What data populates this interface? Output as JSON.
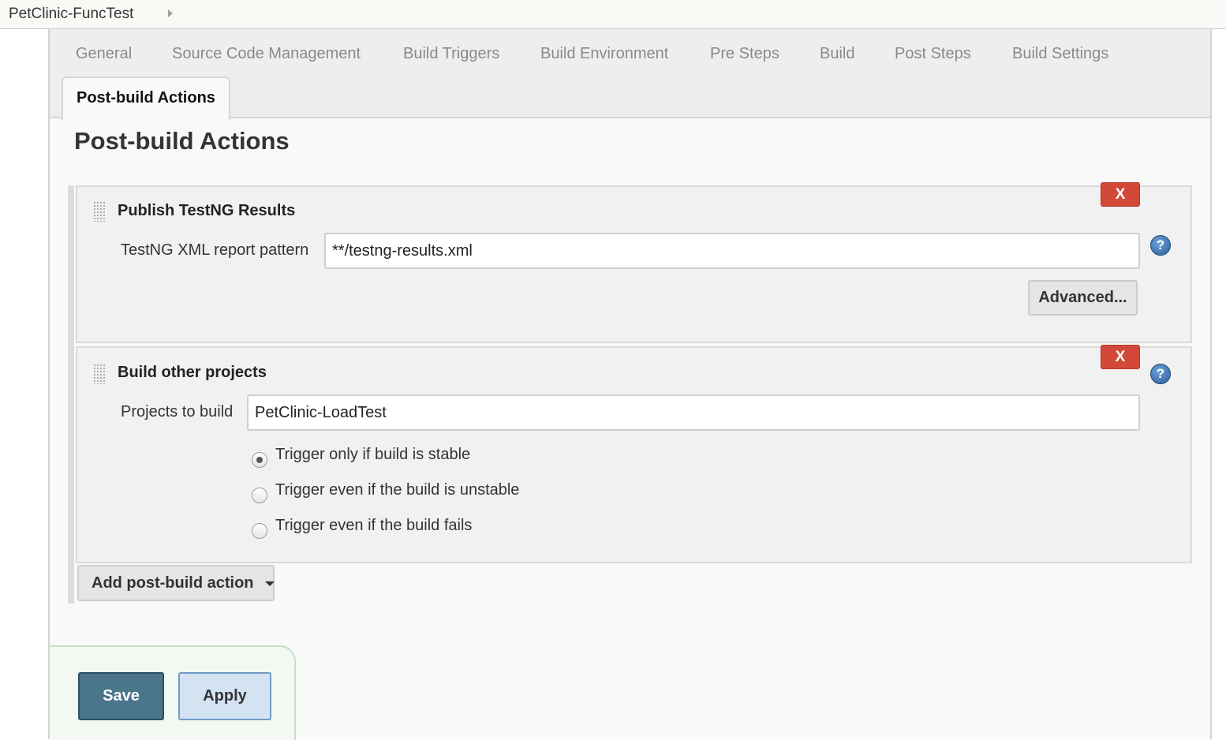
{
  "breadcrumb": {
    "project": "PetClinic-FuncTest"
  },
  "tabs": [
    {
      "label": "General"
    },
    {
      "label": "Source Code Management"
    },
    {
      "label": "Build Triggers"
    },
    {
      "label": "Build Environment"
    },
    {
      "label": "Pre Steps"
    },
    {
      "label": "Build"
    },
    {
      "label": "Post Steps"
    },
    {
      "label": "Build Settings"
    }
  ],
  "active_tab": "Post-build Actions",
  "section": {
    "title": "Post-build Actions"
  },
  "actions": [
    {
      "title": "Publish TestNG Results",
      "delete_label": "X",
      "field_label": "TestNG XML report pattern",
      "field_value": "**/testng-results.xml",
      "advanced_label": "Advanced...",
      "help_icon": "?"
    },
    {
      "title": "Build other projects",
      "delete_label": "X",
      "field_label": "Projects to build",
      "field_value": "PetClinic-LoadTest",
      "help_icon": "?",
      "trigger_options": [
        {
          "label": "Trigger only if build is stable",
          "checked": true
        },
        {
          "label": "Trigger even if the build is unstable",
          "checked": false
        },
        {
          "label": "Trigger even if the build fails",
          "checked": false
        }
      ]
    }
  ],
  "add_action_label": "Add post-build action",
  "buttons": {
    "save": "Save",
    "apply": "Apply"
  },
  "colors": {
    "delete": "#d24939",
    "save": "#4b758b",
    "apply": "#d3e3f2",
    "help": "#2a5e9c"
  }
}
